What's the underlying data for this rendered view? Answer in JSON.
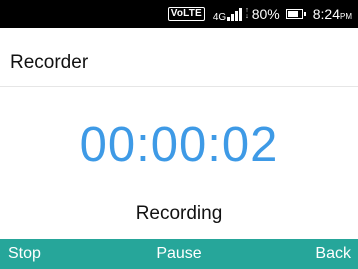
{
  "status_bar": {
    "volte": "VoLTE",
    "network_type": "4G",
    "signal_icon": "signal-bars-icon",
    "data_icon": "data-transfer-arrows-icon",
    "battery_percent": "80%",
    "battery_icon": "battery-icon",
    "battery_level": 0.8,
    "time": "8:24",
    "time_period": "PM"
  },
  "app": {
    "title": "Recorder"
  },
  "recorder": {
    "elapsed": "00:00:02",
    "state": "Recording"
  },
  "softkeys": {
    "left": "Stop",
    "center": "Pause",
    "right": "Back"
  },
  "colors": {
    "timer": "#3e9ae6",
    "softkey_bar": "#26a69a",
    "status_bar": "#000000"
  }
}
